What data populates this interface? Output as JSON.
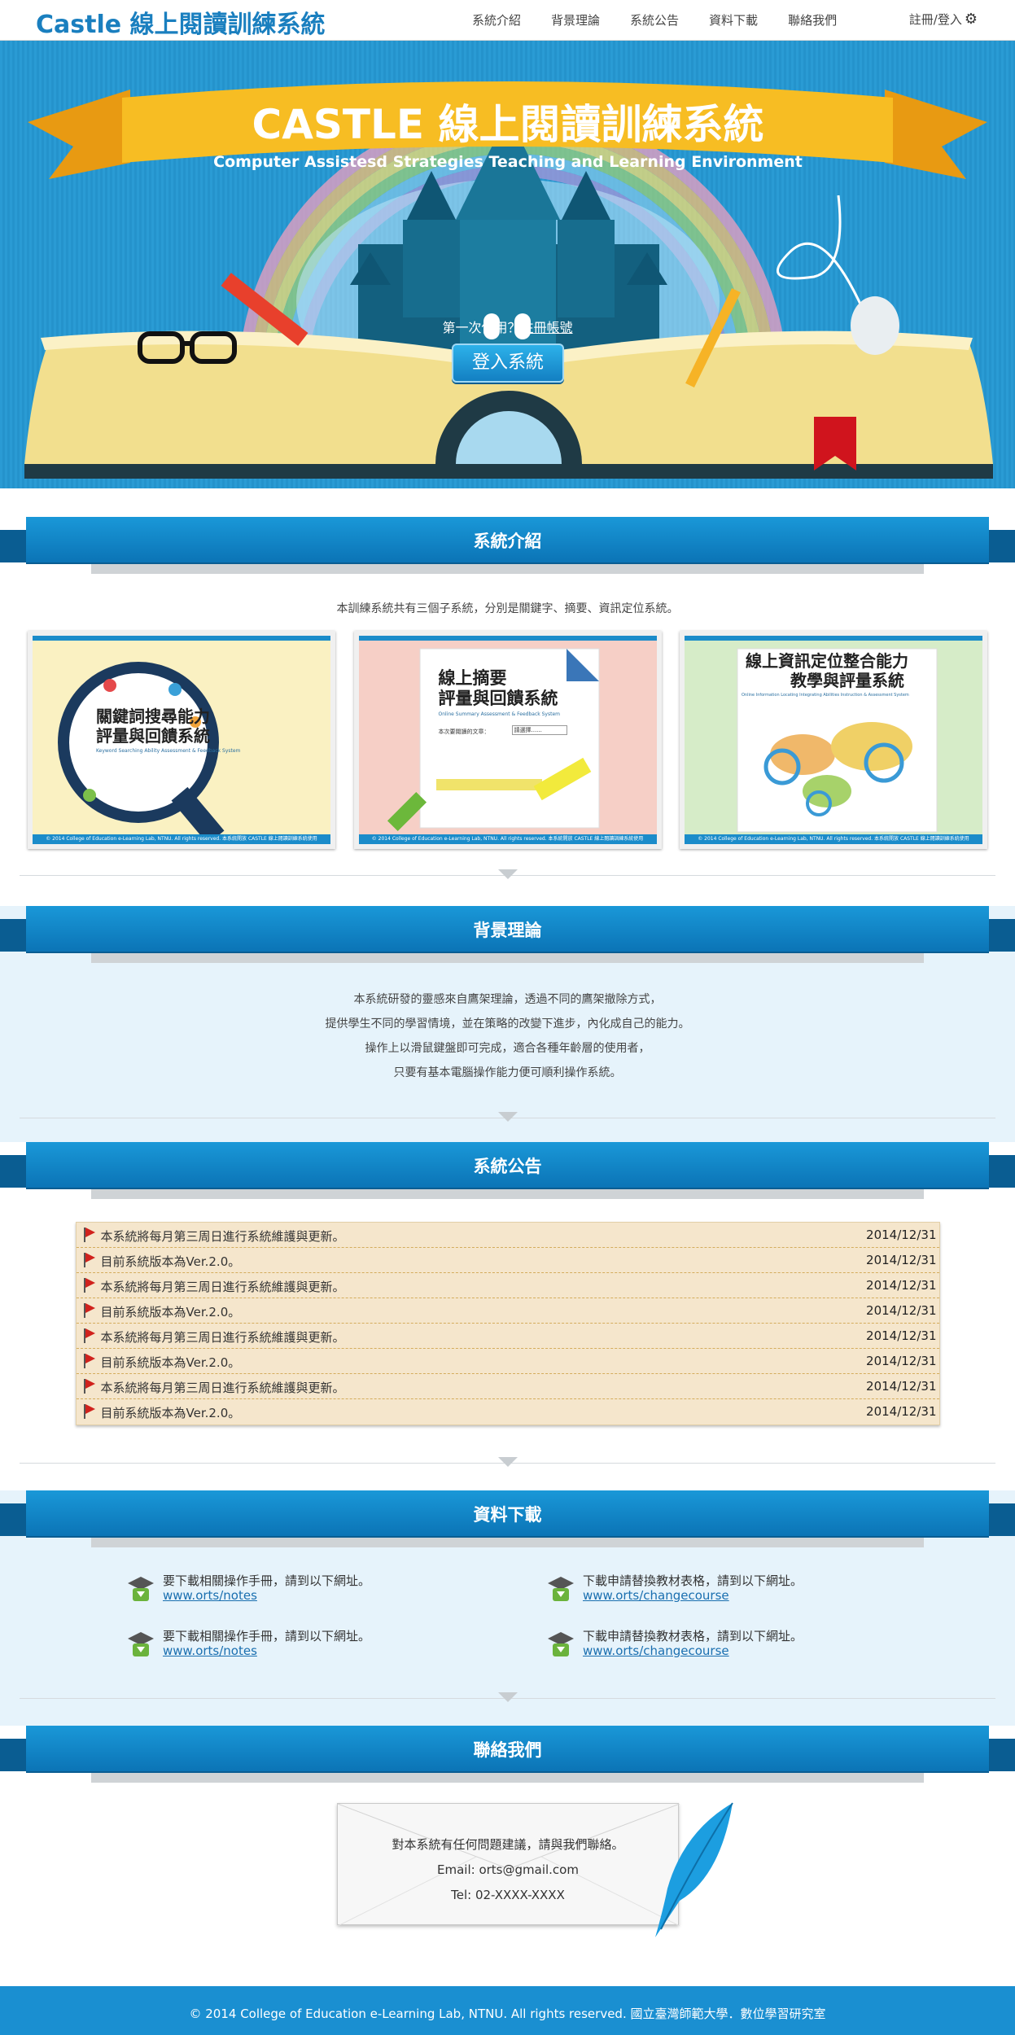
{
  "nav": {
    "brand": "Castle 線上閱讀訓練系統",
    "links": [
      "系統介紹",
      "背景理論",
      "系統公告",
      "資料下載",
      "聯絡我們"
    ],
    "login": "註冊/登入"
  },
  "hero": {
    "title": "CASTLE 線上閱讀訓練系統",
    "subtitle": "Computer Assistesd Strategies Teaching and Learning Environment",
    "first_use": "第一次使用？",
    "register_link": "註冊帳號",
    "login_button": "登入系統"
  },
  "intro": {
    "heading": "系統介紹",
    "text": "本訓練系統共有三個子系統，分別是關鍵字、摘要、資訊定位系統。",
    "cards": [
      {
        "title_line1": "關鍵詞搜尋能力",
        "title_line2": "評量與回饋系統",
        "subtitle": "Keyword Searching Ability Assessment & Feedback System",
        "footer": "© 2014 College of Education e-Learning Lab, NTNU. All rights reserved. 本系統開放 CASTLE 線上閱讀訓練系統使用"
      },
      {
        "title_line1": "線上摘要",
        "title_line2": "評量與回饋系統",
        "subtitle": "Online Summary Assessment & Feedback System",
        "select_label": "本次要閱讀的文章：",
        "select_value": "請選擇......",
        "footer": "© 2014 College of Education e-Learning Lab, NTNU. All rights reserved. 本系統開放 CASTLE 線上閱讀訓練系統使用"
      },
      {
        "title_line1": "線上資訊定位整合能力",
        "title_line2": "教學與評量系統",
        "subtitle": "Online Information Locating Integrating Abilities Instruction & Assessment System",
        "footer": "© 2014 College of Education e-Learning Lab, NTNU. All rights reserved. 本系統開放 CASTLE 線上閱讀訓練系統使用"
      }
    ]
  },
  "background": {
    "heading": "背景理論",
    "lines": [
      "本系統研發的靈感來自鷹架理論，透過不同的鷹架撤除方式，",
      "提供學生不同的學習情境，並在策略的改變下進步，內化成自己的能力。",
      "操作上以滑鼠鍵盤即可完成，適合各種年齡層的使用者，",
      "只要有基本電腦操作能力便可順利操作系統。"
    ]
  },
  "news": {
    "heading": "系統公告",
    "items": [
      {
        "text": "本系統將每月第三周日進行系統維護與更新。",
        "date": "2014/12/31"
      },
      {
        "text": "目前系統版本為Ver.2.0。",
        "date": "2014/12/31"
      },
      {
        "text": "本系統將每月第三周日進行系統維護與更新。",
        "date": "2014/12/31"
      },
      {
        "text": "目前系統版本為Ver.2.0。",
        "date": "2014/12/31"
      },
      {
        "text": "本系統將每月第三周日進行系統維護與更新。",
        "date": "2014/12/31"
      },
      {
        "text": "目前系統版本為Ver.2.0。",
        "date": "2014/12/31"
      },
      {
        "text": "本系統將每月第三周日進行系統維護與更新。",
        "date": "2014/12/31"
      },
      {
        "text": "目前系統版本為Ver.2.0。",
        "date": "2014/12/31"
      }
    ]
  },
  "download": {
    "heading": "資料下載",
    "items": [
      {
        "text": "要下載相關操作手冊，請到以下網址。",
        "link": "www.orts/notes"
      },
      {
        "text": "下載申請替換教材表格，請到以下網址。",
        "link": "www.orts/changecourse"
      },
      {
        "text": "要下載相關操作手冊，請到以下網址。",
        "link": "www.orts/notes"
      },
      {
        "text": "下載申請替換教材表格，請到以下網址。",
        "link": "www.orts/changecourse"
      }
    ]
  },
  "contact": {
    "heading": "聯絡我們",
    "line1": "對本系統有任何問題建議，請與我們聯絡。",
    "email": "Email: orts@gmail.com",
    "tel": "Tel: 02-XXXX-XXXX"
  },
  "footer": {
    "text": "© 2014 College of Education e-Learning Lab, NTNU. All rights reserved. 國立臺灣師範大學．數位學習研究室"
  },
  "colors": {
    "brand": "#1a7fbf",
    "ribbon": "#0c76b8",
    "footer": "#1a8fd1",
    "news_bg": "#f5e6cc",
    "flag": "#d0221d"
  }
}
